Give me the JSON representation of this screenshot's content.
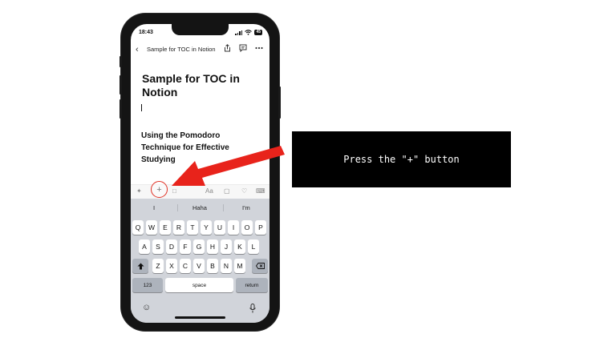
{
  "status_bar": {
    "time": "18:43",
    "battery": "45"
  },
  "nav": {
    "back_icon": "chevron-left-icon",
    "page_title": "Sample for TOC in Notion",
    "icons": [
      "share-icon",
      "comment-icon",
      "more-icon"
    ]
  },
  "document": {
    "title": "Sample for TOC in Notion",
    "heading": "Using the Pomodoro Technique for Effective Studying"
  },
  "toolbar": {
    "plus_label": "+",
    "text_style_label": "Aa",
    "icons": [
      "ai-sparkle-icon",
      "plus-icon",
      "block-icon",
      "text-style-icon",
      "comment-icon",
      "mention-icon",
      "keyboard-dismiss-icon"
    ]
  },
  "keyboard": {
    "suggestions": [
      "I",
      "Haha",
      "I'm"
    ],
    "row1": [
      "Q",
      "W",
      "E",
      "R",
      "T",
      "Y",
      "U",
      "I",
      "O",
      "P"
    ],
    "row2": [
      "A",
      "S",
      "D",
      "F",
      "G",
      "H",
      "J",
      "K",
      "L"
    ],
    "row3": [
      "Z",
      "X",
      "C",
      "V",
      "B",
      "N",
      "M"
    ],
    "numbers_label": "123",
    "space_label": "space",
    "return_label": "return"
  },
  "annotation": {
    "callout_text": "Press the \"+\" button",
    "arrow_color": "#e8231b",
    "highlight_color": "#e03024"
  }
}
